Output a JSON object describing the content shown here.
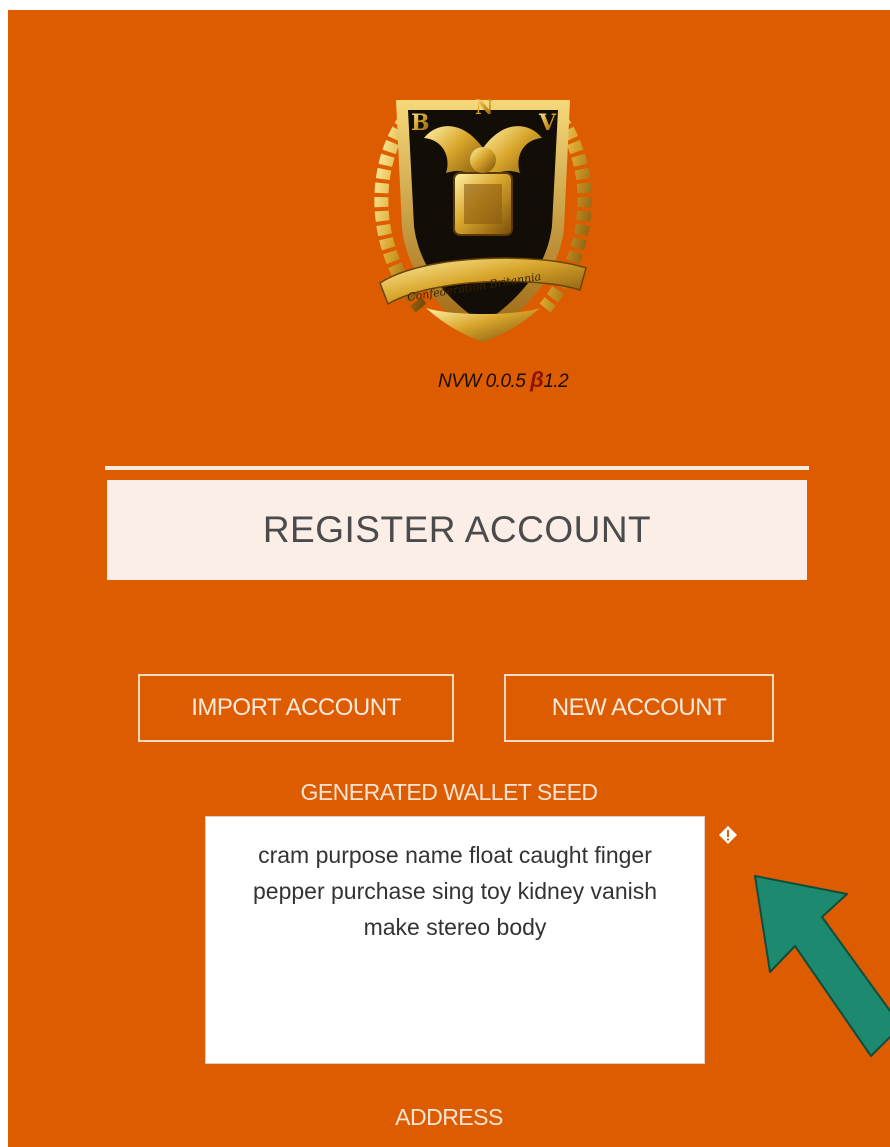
{
  "app": {
    "version_prefix": "NVW 0.0.5 ",
    "version_beta_symbol": "β",
    "version_build": "1.2",
    "logo_letters": [
      "B",
      "N",
      "V"
    ],
    "logo_ribbon_text": "Confederation Britannia"
  },
  "register": {
    "title": "REGISTER ACCOUNT"
  },
  "actions": {
    "import_label": "IMPORT ACCOUNT",
    "new_label": "NEW ACCOUNT"
  },
  "seed": {
    "label": "GENERATED WALLET SEED",
    "value": "cram purpose name float caught finger pepper purchase sing toy kidney vanish make stereo body",
    "info_icon": "info-diamond-icon"
  },
  "address": {
    "label": "ADDRESS"
  },
  "annotation": {
    "arrow_color": "#1d8a70",
    "arrow_icon": "arrow-up-left-icon"
  },
  "colors": {
    "background": "#de5c00",
    "banner": "#fbeee7",
    "accent_text": "#fbe4d4"
  }
}
